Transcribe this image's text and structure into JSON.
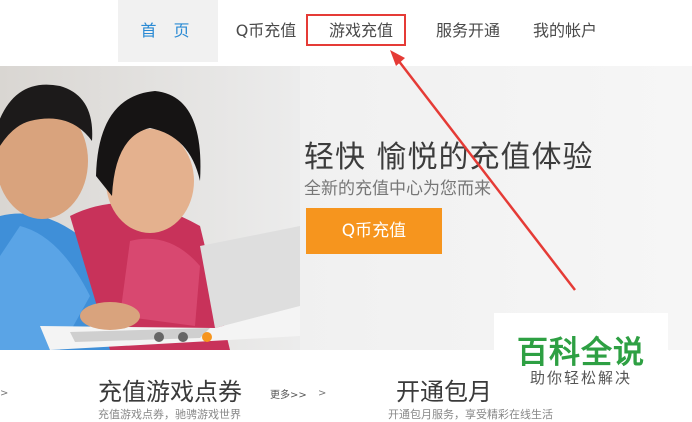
{
  "nav": {
    "items": [
      {
        "label": "首 页",
        "active": true
      },
      {
        "label": "Q币充值",
        "active": false
      },
      {
        "label": "游戏充值",
        "active": false,
        "highlighted": true
      },
      {
        "label": "服务开通",
        "active": false
      },
      {
        "label": "我的帐户",
        "active": false
      }
    ]
  },
  "hero": {
    "title": "轻快 愉悦的充值体验",
    "subtitle": "全新的充值中心为您而来",
    "cta_label": "Q币充值",
    "slides": 3,
    "active_slide": 3
  },
  "cards": {
    "left": {
      "title": "充值游戏点券",
      "description": "充值游戏点券，驰骋游戏世界",
      "more_label": "更多>>"
    },
    "right": {
      "title": "开通包月",
      "description": "开通包月服务，享受精彩在线生活"
    }
  },
  "edge_arrows": {
    "left": ">",
    "right": ">"
  },
  "watermark": {
    "title": "百科全说",
    "subtitle": "助你轻松解决"
  },
  "colors": {
    "accent_orange": "#f6951e",
    "nav_active_blue": "#2a8ad4",
    "highlight_red": "#e53b36",
    "watermark_green": "#2ea043"
  }
}
